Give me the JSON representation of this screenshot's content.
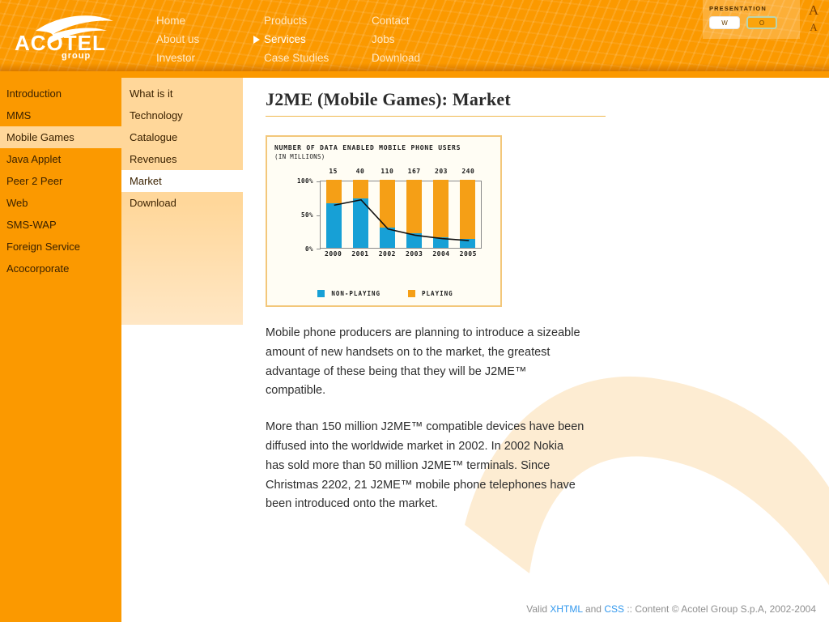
{
  "header": {
    "logo_text": "ACOTEL",
    "logo_sub": "group",
    "nav_columns": [
      {
        "items": [
          {
            "label": "Home",
            "active": false
          },
          {
            "label": "About us",
            "active": false
          },
          {
            "label": "Investor",
            "active": false
          }
        ]
      },
      {
        "items": [
          {
            "label": "Products",
            "active": false
          },
          {
            "label": "Services",
            "active": true
          },
          {
            "label": "Case Studies",
            "active": false
          }
        ]
      },
      {
        "items": [
          {
            "label": "Contact",
            "active": false
          },
          {
            "label": "Jobs",
            "active": false
          },
          {
            "label": "Download",
            "active": false
          }
        ]
      }
    ],
    "presentation": {
      "label": "PRESENTATION",
      "white_button": "W",
      "orange_button": "O",
      "font_increase": "A",
      "font_decrease": "A"
    }
  },
  "sidebar_primary": {
    "items": [
      {
        "label": "Introduction",
        "selected": false
      },
      {
        "label": "MMS",
        "selected": false
      },
      {
        "label": "Mobile Games",
        "selected": true
      },
      {
        "label": "Java Applet",
        "selected": false
      },
      {
        "label": "Peer 2 Peer",
        "selected": false
      },
      {
        "label": "Web",
        "selected": false
      },
      {
        "label": "SMS-WAP",
        "selected": false
      },
      {
        "label": "Foreign Service",
        "selected": false
      },
      {
        "label": "Acocorporate",
        "selected": false
      }
    ]
  },
  "sidebar_secondary": {
    "items": [
      {
        "label": "What is it",
        "selected": false
      },
      {
        "label": "Technology",
        "selected": false
      },
      {
        "label": "Catalogue",
        "selected": false
      },
      {
        "label": "Revenues",
        "selected": false
      },
      {
        "label": "Market",
        "selected": true
      },
      {
        "label": "Download",
        "selected": false
      }
    ]
  },
  "main": {
    "title": "J2ME (Mobile Games): Market",
    "paragraphs": [
      "Mobile phone producers are planning to introduce a sizeable amount of new handsets on to the market, the greatest advantage of these being that they will be J2ME™ compatible.",
      "More than 150 million J2ME™ compatible devices have been diffused into the worldwide market in 2002. In 2002 Nokia has sold more than 50 million J2ME™ terminals. Since Christmas 2202, 21 J2ME™ mobile phone telephones have been introduced onto the market."
    ]
  },
  "chart_data": {
    "type": "bar",
    "title": "NUMBER OF DATA ENABLED MOBILE PHONE USERS",
    "subtitle": "(IN MILLIONS)",
    "categories": [
      "2000",
      "2001",
      "2002",
      "2003",
      "2004",
      "2005"
    ],
    "top_labels": [
      "15",
      "40",
      "110",
      "167",
      "203",
      "240"
    ],
    "series": [
      {
        "name": "NON-PLAYING",
        "color": "#17a0d6",
        "values": [
          65,
          73,
          30,
          21,
          16,
          13
        ]
      },
      {
        "name": "PLAYING",
        "color": "#f59f16",
        "values": [
          35,
          27,
          70,
          79,
          84,
          87
        ]
      }
    ],
    "line_series": {
      "name": "non-playing trend",
      "values": [
        65,
        73,
        30,
        21,
        16,
        13
      ],
      "color": "#111111"
    },
    "ytick_labels": [
      "100%",
      "50%",
      "0%"
    ],
    "ylim": [
      0,
      100
    ],
    "xlabel": "",
    "ylabel": "",
    "grid": false,
    "stacked": true,
    "legend_position": "bottom"
  },
  "footer": {
    "prefix": "Valid ",
    "link_xhtml": "XHTML",
    "mid": " and ",
    "link_css": "CSS",
    "suffix": " :: Content © Acotel Group S.p.A, 2002-2004"
  },
  "colors": {
    "brand_orange": "#fb9900",
    "sidebar_selected": "#ffd79a",
    "accent_blue": "#17a0d6",
    "accent_orange": "#f59f16",
    "link_blue": "#3399ee"
  }
}
